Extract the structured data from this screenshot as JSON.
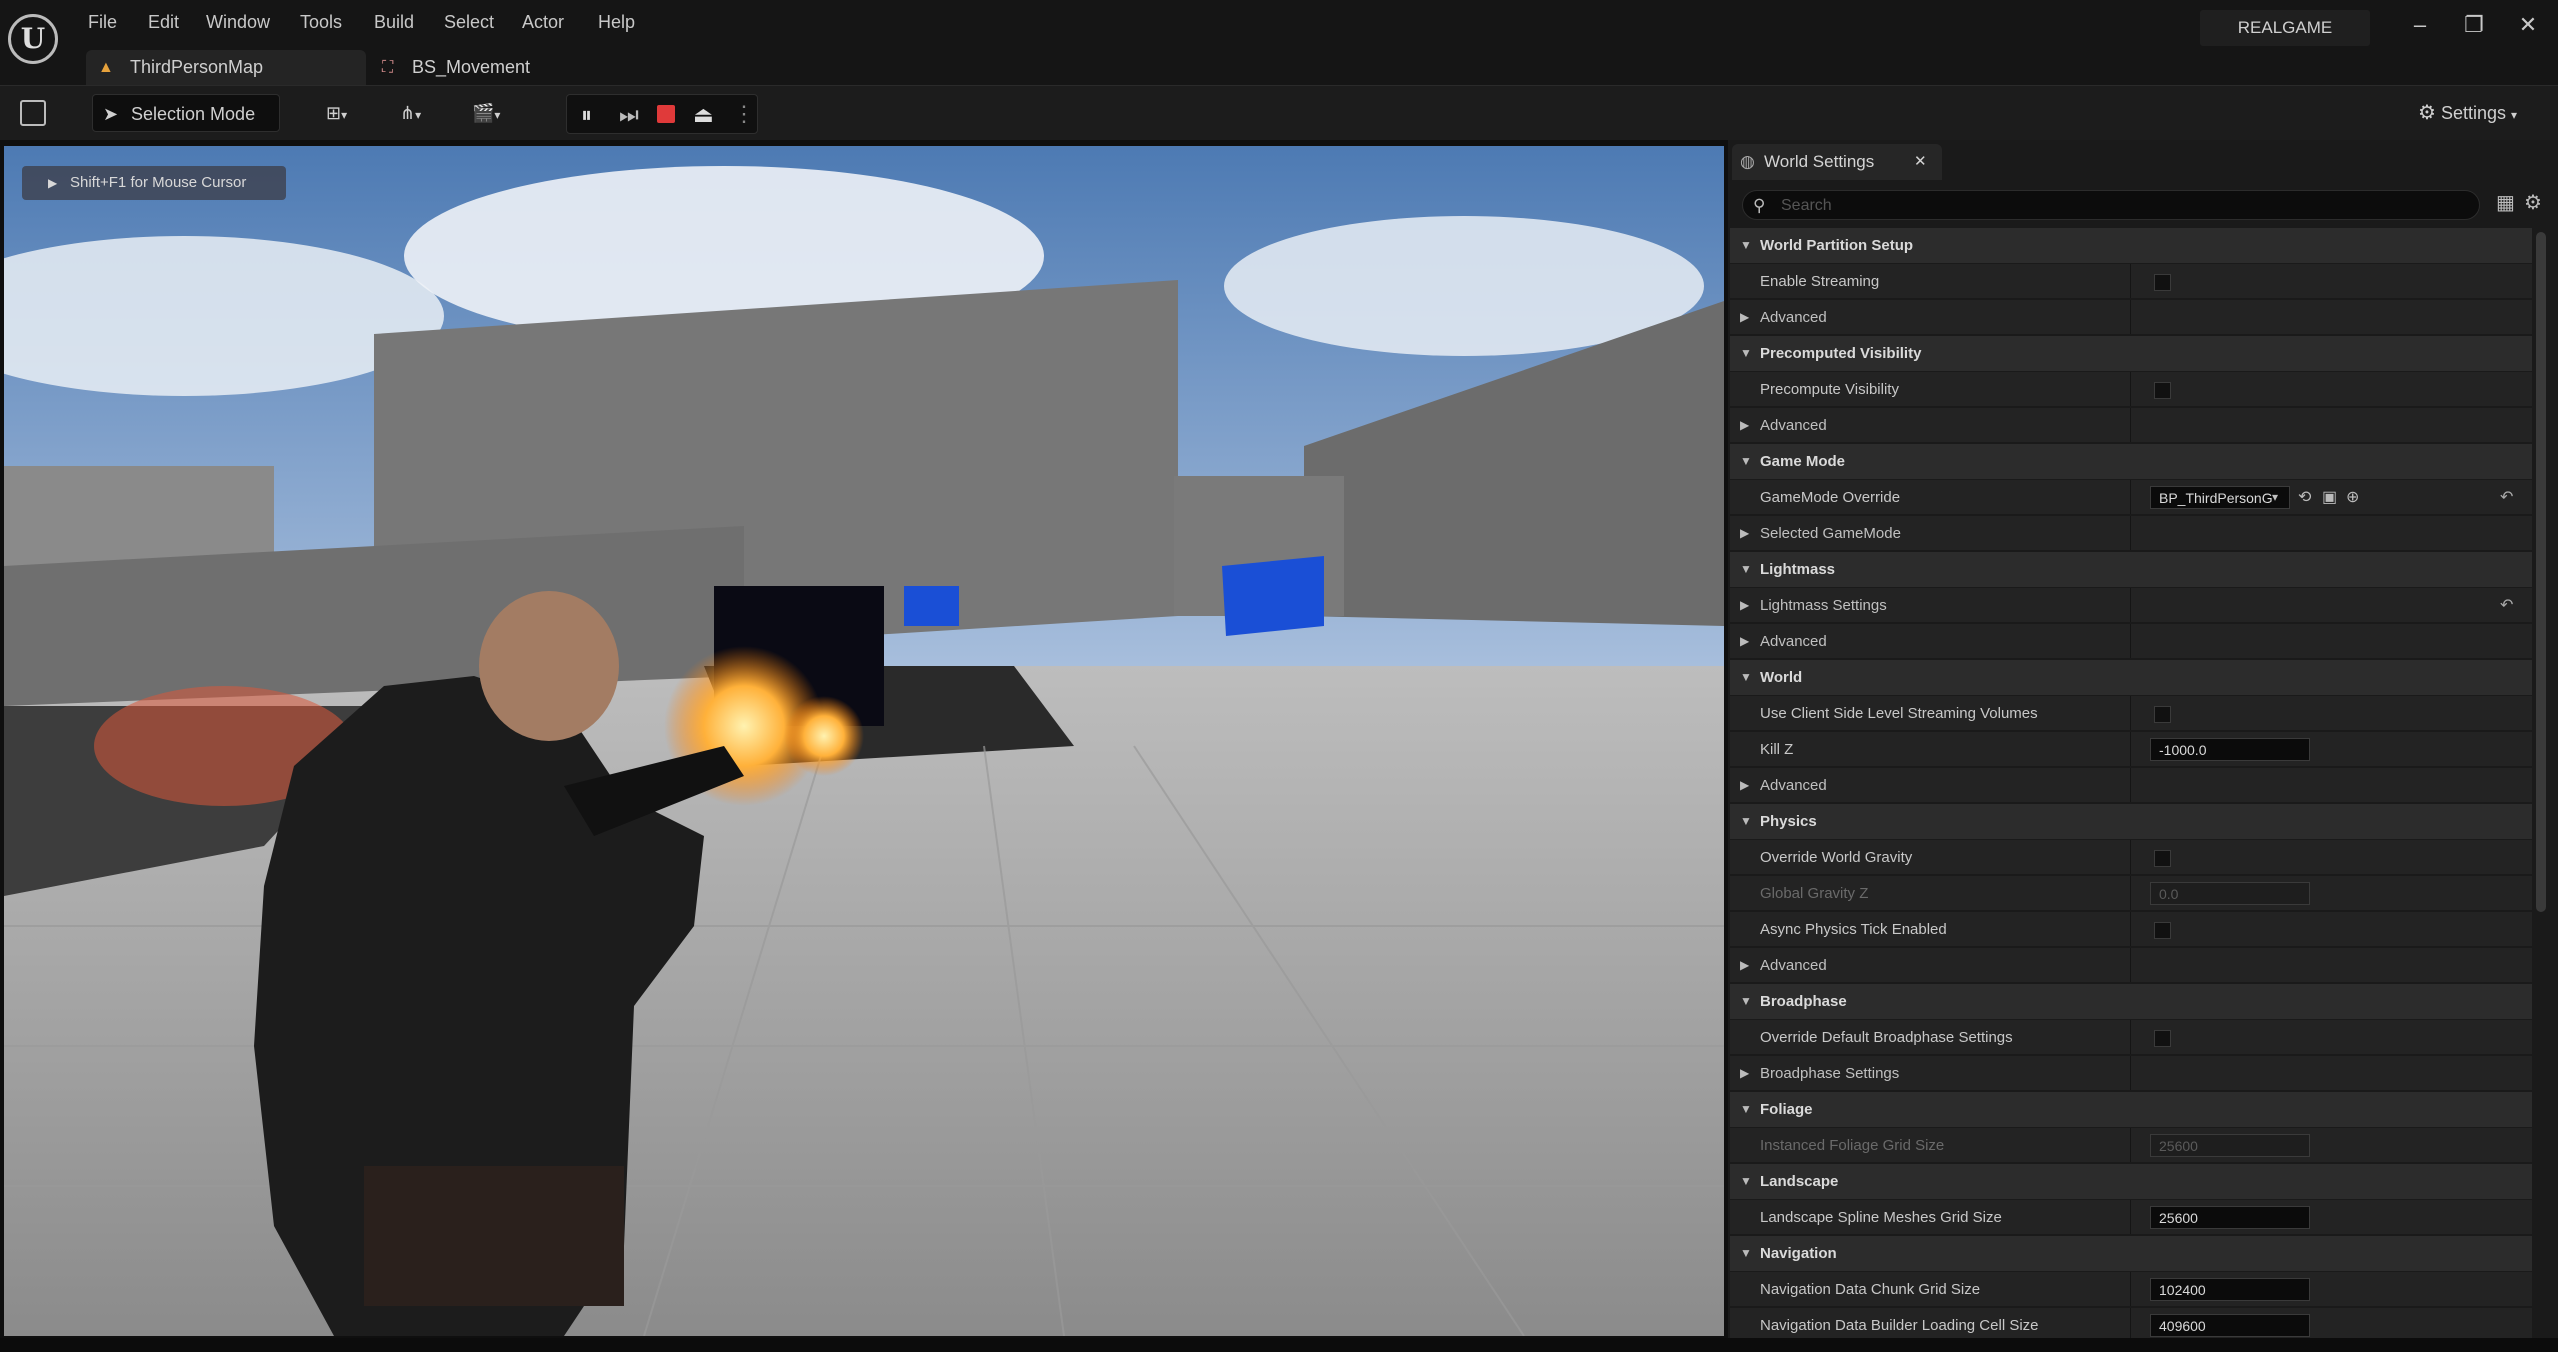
{
  "menu": [
    "File",
    "Edit",
    "Window",
    "Tools",
    "Build",
    "Select",
    "Actor",
    "Help"
  ],
  "project_name": "REALGAME",
  "tabs": [
    {
      "label": "ThirdPersonMap"
    },
    {
      "label": "BS_Movement"
    }
  ],
  "toolbar": {
    "selection_mode": "Selection Mode",
    "settings": "Settings"
  },
  "viewport": {
    "hint": "Shift+F1 for Mouse Cursor"
  },
  "panel": {
    "title": "World Settings",
    "search_placeholder": "Search",
    "rows": [
      {
        "kind": "cat",
        "label": "World Partition Setup"
      },
      {
        "kind": "prop",
        "label": "Enable Streaming",
        "control": "checkbox"
      },
      {
        "kind": "sub",
        "label": "Advanced"
      },
      {
        "kind": "cat",
        "label": "Precomputed Visibility"
      },
      {
        "kind": "prop",
        "label": "Precompute Visibility",
        "control": "checkbox"
      },
      {
        "kind": "sub",
        "label": "Advanced"
      },
      {
        "kind": "cat",
        "label": "Game Mode"
      },
      {
        "kind": "prop",
        "label": "GameMode Override",
        "control": "dropdown",
        "value": "BP_ThirdPersonG"
      },
      {
        "kind": "sub",
        "label": "Selected GameMode"
      },
      {
        "kind": "cat",
        "label": "Lightmass"
      },
      {
        "kind": "sub",
        "label": "Lightmass Settings",
        "reset": true
      },
      {
        "kind": "sub",
        "label": "Advanced"
      },
      {
        "kind": "cat",
        "label": "World"
      },
      {
        "kind": "prop",
        "label": "Use Client Side Level Streaming Volumes",
        "control": "checkbox"
      },
      {
        "kind": "prop",
        "label": "Kill Z",
        "control": "field",
        "value": "-1000.0"
      },
      {
        "kind": "sub",
        "label": "Advanced"
      },
      {
        "kind": "cat",
        "label": "Physics"
      },
      {
        "kind": "prop",
        "label": "Override World Gravity",
        "control": "checkbox"
      },
      {
        "kind": "prop",
        "label": "Global Gravity Z",
        "control": "field",
        "value": "0.0",
        "dim": true
      },
      {
        "kind": "prop",
        "label": "Async Physics Tick Enabled",
        "control": "checkbox"
      },
      {
        "kind": "sub",
        "label": "Advanced"
      },
      {
        "kind": "cat",
        "label": "Broadphase"
      },
      {
        "kind": "prop",
        "label": "Override Default Broadphase Settings",
        "control": "checkbox"
      },
      {
        "kind": "sub",
        "label": "Broadphase Settings"
      },
      {
        "kind": "cat",
        "label": "Foliage"
      },
      {
        "kind": "prop",
        "label": "Instanced Foliage Grid Size",
        "control": "field",
        "value": "25600",
        "dim": true
      },
      {
        "kind": "cat",
        "label": "Landscape"
      },
      {
        "kind": "prop",
        "label": "Landscape Spline Meshes Grid Size",
        "control": "field",
        "value": "25600"
      },
      {
        "kind": "cat",
        "label": "Navigation"
      },
      {
        "kind": "prop",
        "label": "Navigation Data Chunk Grid Size",
        "control": "field",
        "value": "102400"
      },
      {
        "kind": "prop",
        "label": "Navigation Data Builder Loading Cell Size",
        "control": "field",
        "value": "409600"
      }
    ]
  }
}
